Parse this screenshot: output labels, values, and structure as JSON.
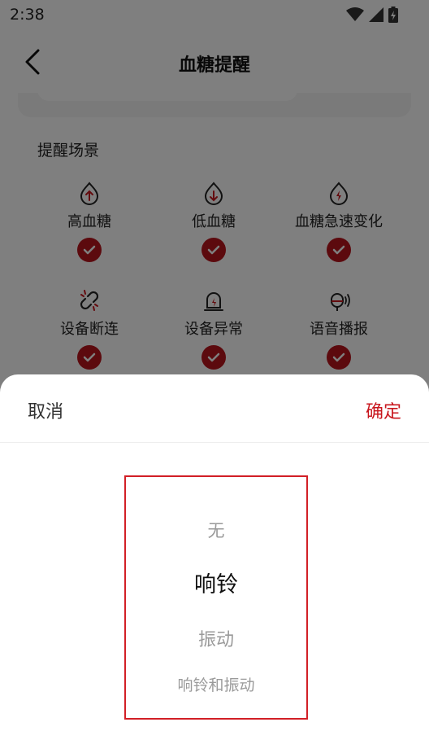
{
  "status_bar": {
    "time": "2:38"
  },
  "header": {
    "title": "血糖提醒"
  },
  "section": {
    "title": "提醒场景"
  },
  "scenes": [
    {
      "label": "高血糖",
      "icon": "drop-arrow-up-icon"
    },
    {
      "label": "低血糖",
      "icon": "drop-arrow-down-icon"
    },
    {
      "label": "血糖急速变化",
      "icon": "drop-lightning-icon"
    },
    {
      "label": "设备断连",
      "icon": "broken-link-icon"
    },
    {
      "label": "设备异常",
      "icon": "alarm-light-icon"
    },
    {
      "label": "语音播报",
      "icon": "microphone-sound-icon"
    }
  ],
  "sheet": {
    "cancel_label": "取消",
    "confirm_label": "确定",
    "options": [
      "无",
      "响铃",
      "振动",
      "响铃和振动"
    ],
    "selected": "响铃"
  },
  "colors": {
    "accent": "#c8161d",
    "check": "#b8151c"
  }
}
